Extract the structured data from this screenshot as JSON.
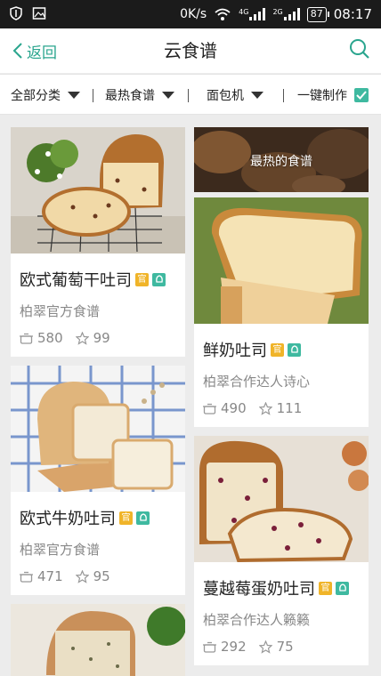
{
  "status_bar": {
    "network_speed": "0K/s",
    "net_4g": "4G",
    "net_2g": "2G",
    "battery": "87",
    "time": "08:17"
  },
  "header": {
    "back_label": "返回",
    "title": "云食谱"
  },
  "filters": {
    "category": "全部分类",
    "sort": "最热食谱",
    "machine": "面包机",
    "one_click": "一键制作",
    "one_click_checked": true
  },
  "badges": {
    "official": "官"
  },
  "banner": {
    "text": "最热的食谱"
  },
  "recipes": [
    {
      "name": "欧式葡萄干吐司",
      "author": "柏翠官方食谱",
      "makes": "580",
      "favorites": "99"
    },
    {
      "name": "鲜奶吐司",
      "author": "柏翠合作达人诗心",
      "makes": "490",
      "favorites": "111"
    },
    {
      "name": "欧式牛奶吐司",
      "author": "柏翠官方食谱",
      "makes": "471",
      "favorites": "95"
    },
    {
      "name": "蔓越莓蛋奶吐司",
      "author": "柏翠合作达人籁籁",
      "makes": "292",
      "favorites": "75"
    }
  ],
  "colors": {
    "accent": "#2aa58e",
    "official_badge": "#f0b429",
    "machine_badge": "#3fb9a0"
  }
}
